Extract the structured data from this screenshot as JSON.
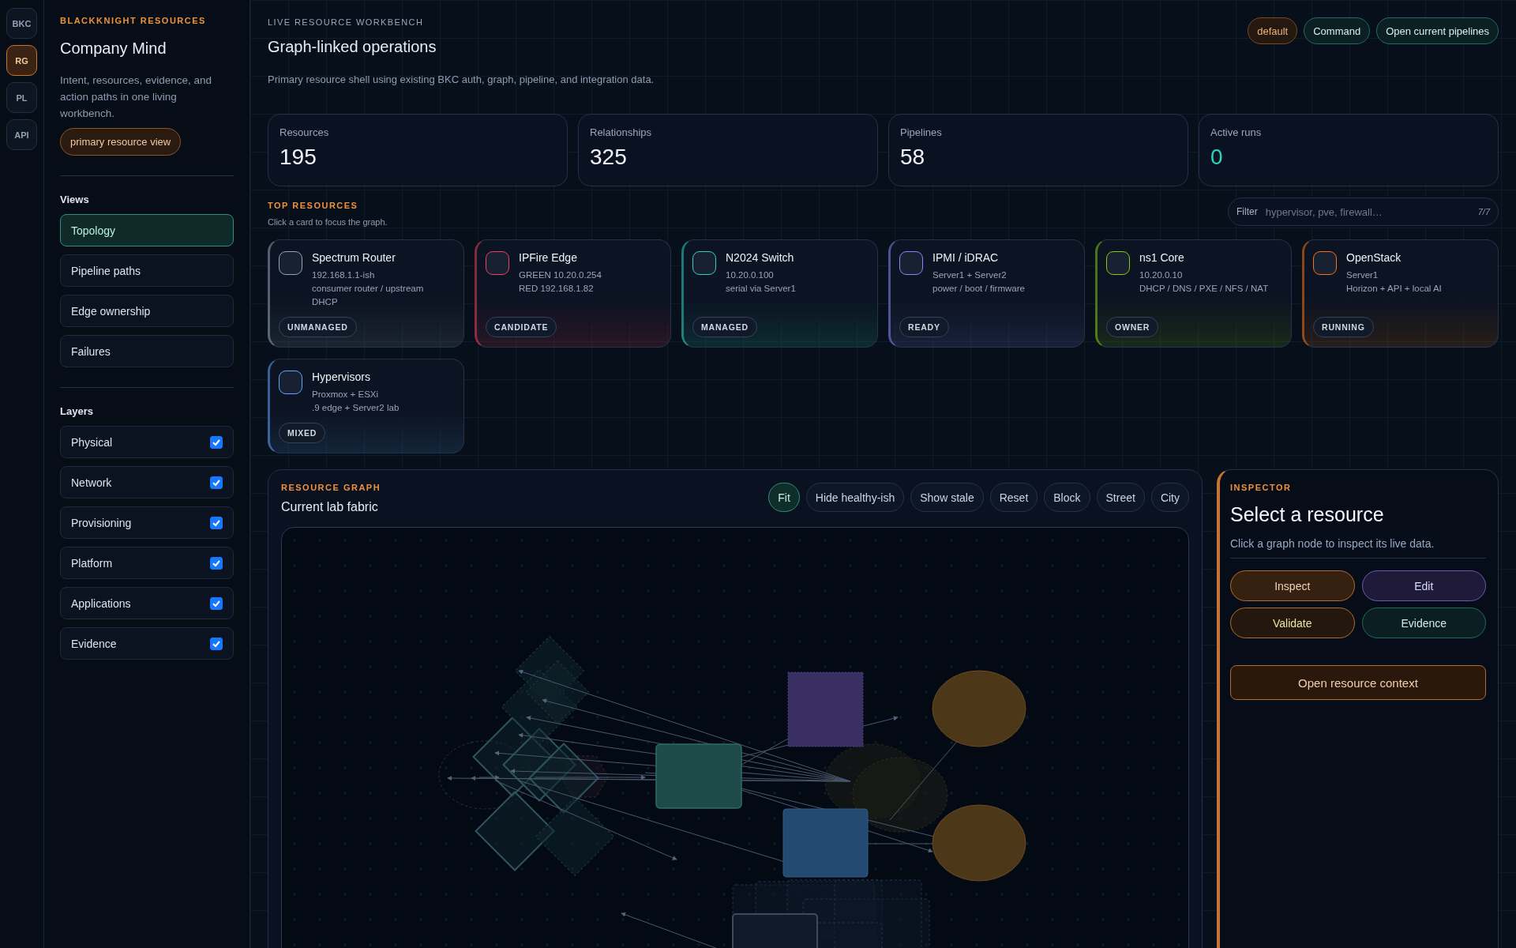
{
  "rail": [
    {
      "label": "BKC",
      "selected": false
    },
    {
      "label": "RG",
      "selected": true
    },
    {
      "label": "PL",
      "selected": false
    },
    {
      "label": "API",
      "selected": false
    }
  ],
  "sidebar": {
    "eyebrow": "BLACKKNIGHT RESOURCES",
    "title": "Company Mind",
    "description": "Intent, resources, evidence, and action paths in one living workbench.",
    "badge": "primary resource view",
    "views_heading": "Views",
    "views": [
      {
        "label": "Topology",
        "selected": true
      },
      {
        "label": "Pipeline paths",
        "selected": false
      },
      {
        "label": "Edge ownership",
        "selected": false
      },
      {
        "label": "Failures",
        "selected": false
      }
    ],
    "layers_heading": "Layers",
    "layers": [
      {
        "label": "Physical",
        "checked": true
      },
      {
        "label": "Network",
        "checked": true
      },
      {
        "label": "Provisioning",
        "checked": true
      },
      {
        "label": "Platform",
        "checked": true
      },
      {
        "label": "Applications",
        "checked": true
      },
      {
        "label": "Evidence",
        "checked": true
      }
    ]
  },
  "header": {
    "eyebrow": "LIVE RESOURCE WORKBENCH",
    "title": "Graph-linked operations",
    "description": "Primary resource shell using existing BKC auth, graph, pipeline, and integration data.",
    "actions": [
      {
        "label": "default",
        "kind": "profile"
      },
      {
        "label": "Command",
        "kind": "action"
      },
      {
        "label": "Open current pipelines",
        "kind": "action"
      }
    ]
  },
  "stats": [
    {
      "label": "Resources",
      "value": "195",
      "highlight": false
    },
    {
      "label": "Relationships",
      "value": "325",
      "highlight": false
    },
    {
      "label": "Pipelines",
      "value": "58",
      "highlight": false
    },
    {
      "label": "Active runs",
      "value": "0",
      "highlight": true
    }
  ],
  "top_resources": {
    "eyebrow": "TOP RESOURCES",
    "hint": "Click a card to focus the graph.",
    "filter": {
      "label": "Filter",
      "placeholder": "hypervisor, pve, firewall…",
      "count": "7/7"
    },
    "cards": [
      {
        "name": "Spectrum Router",
        "lines": [
          "192.168.1.1-ish",
          "consumer router / upstream DHCP"
        ],
        "status": "UNMANAGED",
        "color": "#94a3b8"
      },
      {
        "name": "IPFire Edge",
        "lines": [
          "GREEN 10.20.0.254",
          "RED 192.168.1.82"
        ],
        "status": "CANDIDATE",
        "color": "#f43f5e"
      },
      {
        "name": "N2024 Switch",
        "lines": [
          "10.20.0.100",
          "serial via Server1"
        ],
        "status": "MANAGED",
        "color": "#2dd4bf"
      },
      {
        "name": "IPMI / iDRAC",
        "lines": [
          "Server1 + Server2",
          "power / boot / firmware"
        ],
        "status": "READY",
        "color": "#818cf8"
      },
      {
        "name": "ns1 Core",
        "lines": [
          "10.20.0.10",
          "DHCP / DNS / PXE / NFS / NAT"
        ],
        "status": "OWNER",
        "color": "#84cc16"
      },
      {
        "name": "OpenStack",
        "lines": [
          "Server1",
          "Horizon + API + local AI"
        ],
        "status": "RUNNING",
        "color": "#f97316"
      },
      {
        "name": "Hypervisors",
        "lines": [
          "Proxmox + ESXi",
          ".9 edge + Server2 lab"
        ],
        "status": "MIXED",
        "color": "#60a5fa"
      }
    ]
  },
  "graph": {
    "eyebrow": "RESOURCE GRAPH",
    "title": "Current lab fabric",
    "controls": [
      {
        "label": "Fit",
        "selected": true
      },
      {
        "label": "Hide healthy-ish",
        "selected": false
      },
      {
        "label": "Show stale",
        "selected": false
      },
      {
        "label": "Reset",
        "selected": false
      },
      {
        "label": "Block",
        "selected": false
      },
      {
        "label": "Street",
        "selected": false
      },
      {
        "label": "City",
        "selected": false
      }
    ]
  },
  "inspector": {
    "eyebrow": "INSPECTOR",
    "title": "Select a resource",
    "hint": "Click a graph node to inspect its live data.",
    "actions": [
      {
        "label": "Inspect",
        "kind": "inspect"
      },
      {
        "label": "Edit",
        "kind": "edit"
      },
      {
        "label": "Validate",
        "kind": "validate"
      },
      {
        "label": "Evidence",
        "kind": "evidence"
      }
    ],
    "primary": "Open resource context"
  }
}
